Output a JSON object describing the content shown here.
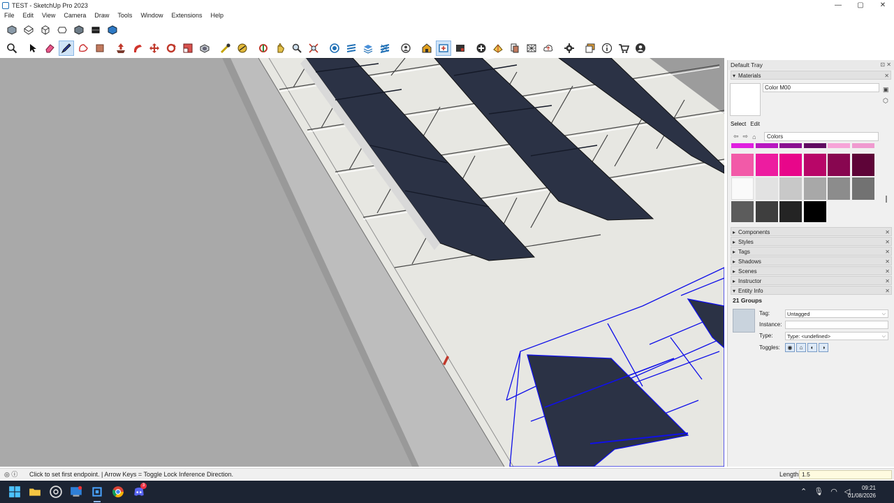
{
  "window": {
    "title": "TEST - SketchUp Pro 2023",
    "controls": [
      "—",
      "▢",
      "✕"
    ]
  },
  "menu": [
    "File",
    "Edit",
    "View",
    "Camera",
    "Draw",
    "Tools",
    "Window",
    "Extensions",
    "Help"
  ],
  "toolbar": {
    "row1_icons": [
      "iso-view-icon",
      "top-view-icon",
      "front-view-icon",
      "right-view-icon",
      "back-view-icon",
      "left-view-icon",
      "bottom-view-icon"
    ],
    "row2_icons": [
      "search-icon",
      "select-icon",
      "eraser-icon",
      "pencil-line-icon",
      "shape-icon",
      "paint-bucket-icon",
      "push-pull-icon",
      "follow-me-icon",
      "move-icon",
      "rotate-icon",
      "scale-icon",
      "offset-icon",
      "tape-measure-icon",
      "protractor-icon",
      "orbit-icon",
      "pan-icon",
      "zoom-icon",
      "zoom-extents-icon",
      "section-plane-icon",
      "display-sections-icon",
      "layers-icon",
      "component-icon",
      "user-icon",
      "warehouse-icon",
      "extension-warehouse-icon",
      "layout-icon",
      "add-location-icon",
      "sandbox-icon",
      "solid-tools-icon",
      "cloud-icon",
      "settings-icon",
      "scenes-icon",
      "info-icon",
      "cart-icon",
      "account-icon"
    ]
  },
  "tray": {
    "title": "Default Tray",
    "materials_header": "Materials",
    "material_name": "Color M00",
    "tabs": [
      "Select",
      "Edit"
    ],
    "collection": "Colors",
    "swatch_colors": [
      [
        "#e020e0",
        "#b818c0",
        "#8a1090",
        "#600a60",
        "#f7a4d8",
        "#f09ad0"
      ],
      [
        "#f25aa8",
        "#ed1ca0",
        "#e8068a",
        "#b80668",
        "#880650",
        "#5e0438"
      ],
      [
        "#fafafa",
        "#e2e2e2",
        "#c8c8c8",
        "#a8a8a8",
        "#8c8c8c",
        "#727272"
      ],
      [
        "#5c5c5c",
        "#3e3e3e",
        "#242424",
        "#000000"
      ]
    ],
    "panels": [
      "Components",
      "Styles",
      "Tags",
      "Shadows",
      "Scenes",
      "Instructor",
      "Entity Info"
    ],
    "entity_info": {
      "title": "21 Groups",
      "tag_label": "Tag:",
      "tag_value": "Untagged",
      "instance_label": "Instance:",
      "instance_value": "",
      "type_label": "Type:",
      "type_value": "Type: <undefined>",
      "toggles_label": "Toggles:"
    }
  },
  "status": {
    "message": "Click to set first endpoint. | Arrow Keys = Toggle Lock Inference Direction.",
    "length_label": "Length",
    "length_value": "1.5"
  },
  "taskbar": {
    "apps": [
      "windows-start-icon",
      "file-explorer-icon",
      "sketchup-icon",
      "chrome-icon",
      "sketchup-active-icon",
      "chrome2-icon",
      "discord-icon"
    ],
    "time": "09:21",
    "date": "01/08/2026",
    "discord_badge": "3"
  },
  "colors": {
    "panel_dark": "#2b3245",
    "accent": "#1f6fb5",
    "selection_blue": "#1010e8"
  }
}
